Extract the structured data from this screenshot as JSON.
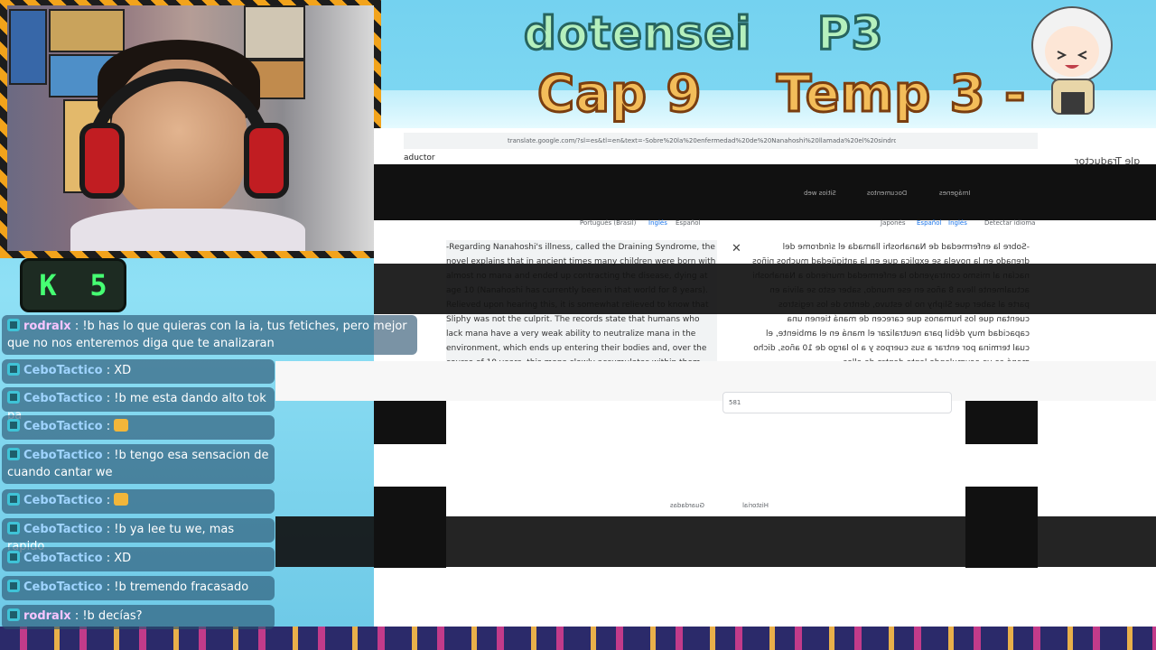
{
  "banner": {
    "line1_left": "dotensei",
    "line1_right": "P3",
    "line2_left": "Cap 9",
    "line2_right": "Temp 3 -"
  },
  "badge": {
    "k": "K",
    "num": "5"
  },
  "chat": [
    {
      "user": "rodralx",
      "msg": ": !b has lo que quieras con la ia, tus fetiches, pero mejor que no nos enteremos diga que te analizaran"
    },
    {
      "user": "CeboTactico",
      "msg": ": XD"
    },
    {
      "user": "CeboTactico",
      "msg": ": !b me esta dando alto tok pa"
    },
    {
      "user": "CeboTactico",
      "msg": ":"
    },
    {
      "user": "CeboTactico",
      "msg": ": !b tengo esa sensacion de cuando cantar we"
    },
    {
      "user": "CeboTactico",
      "msg": ":"
    },
    {
      "user": "CeboTactico",
      "msg": ": !b ya lee tu we, mas rapido"
    },
    {
      "user": "CeboTactico",
      "msg": ": XD"
    },
    {
      "user": "CeboTactico",
      "msg": ": !b tremendo fracasado"
    },
    {
      "user": "rodralx",
      "msg": ": !b decías?"
    }
  ],
  "translator": {
    "url": "translate.google.com/?sl=es&tl=en&text=-Sobre%20la%20enfermedad%20de%20Nanahoshi%20llamada%20el%20sindrome%20del%20drenado...",
    "tab_title": "aductor",
    "app_title": "gle Traductor",
    "mode_images": "Imágenes",
    "mode_docs": "Documentos",
    "mode_web": "Sitios web",
    "src_langs": [
      "Detectar idioma",
      "Inglés",
      "Español",
      "Japonés"
    ],
    "tgt_langs": [
      "Español",
      "Inglés",
      "Portugués (Brasil)"
    ],
    "source_text": "-Sobre la enfermedad de Nanahoshi llamada el síndrome del drenado en la novela se explica que en la antigüedad muchos niños nacían al mismo contrayendo la enfermedad muriendo a Nanahoshi actualmente lleva 8 años en ese mundo, saber esto se alivia en parte al saber que Sliphy no lo estuvo, dentro de los registros cuentan que los humanos que carecen de maná tienen una capacidad muy débil para neutralizar el maná en el ambiente, el cual termina por entrar a sus cuerpos y a lo largo de 10 años, dicho maná se va acumulando lento dentro de ellos",
    "target_text": "-Regarding Nanahoshi's illness, called the Draining Syndrome, the novel explains that in ancient times many children were born with almost no mana and ended up contracting the disease, dying at age 10 (Nanahoshi has currently been in that world for 8 years). Relieved upon hearing this, it is somewhat relieved to know that Sliphy was not the culprit. The records state that humans who lack mana have a very weak ability to neutralize mana in the environment, which ends up entering their bodies and, over the course of 10 years, this mana slowly accumulates within them until it causes this disease that drains",
    "char_count": "581",
    "history": "Historial",
    "saved": "Guardadas"
  }
}
